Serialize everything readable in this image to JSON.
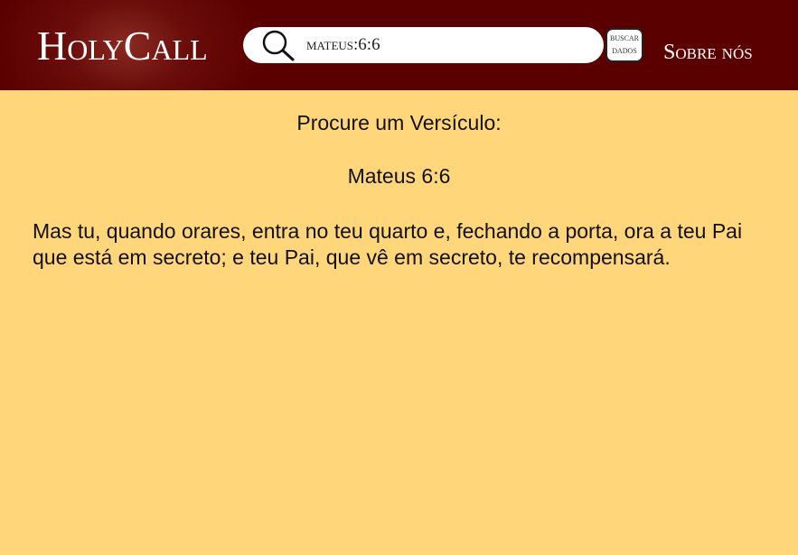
{
  "header": {
    "logo": "HolyCall",
    "search": {
      "value": "mateus:6:6",
      "button_line1": "BUSCAR",
      "button_line2": "DADOS"
    },
    "about_label": "Sobre nós"
  },
  "main": {
    "prompt": "Procure um Versículo:",
    "reference": "Mateus 6:6",
    "verse": "Mas tu, quando orares, entra no teu quarto e, fechando a porta, ora a teu Pai que está em secreto; e teu Pai, que vê em secreto, te recompensará."
  },
  "colors": {
    "header_bg": "#5a0000",
    "page_bg": "#ffd67a",
    "text": "#111111",
    "header_text": "#ffffff"
  },
  "icons": {
    "search": "magnifying-glass"
  }
}
